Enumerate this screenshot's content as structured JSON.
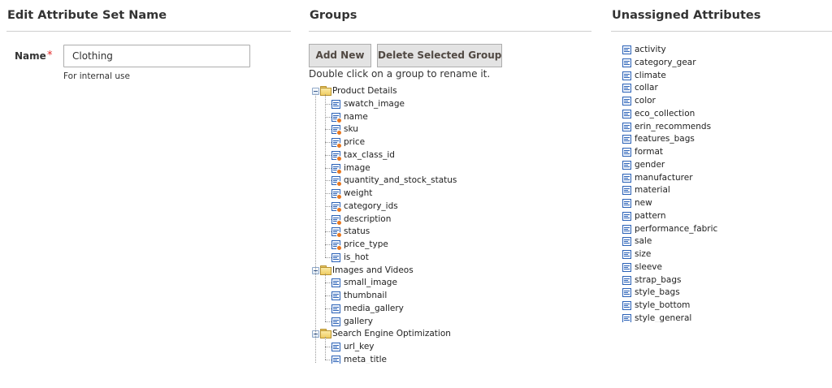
{
  "name_section": {
    "title": "Edit Attribute Set Name",
    "label": "Name",
    "required": "*",
    "value": "Clothing",
    "note": "For internal use"
  },
  "groups_section": {
    "title": "Groups",
    "add_label": "Add New",
    "delete_label": "Delete Selected Group",
    "hint": "Double click on a group to rename it.",
    "groups": [
      {
        "name": "Product Details",
        "items": [
          {
            "label": "swatch_image",
            "system": false
          },
          {
            "label": "name",
            "system": true
          },
          {
            "label": "sku",
            "system": true
          },
          {
            "label": "price",
            "system": true
          },
          {
            "label": "tax_class_id",
            "system": true
          },
          {
            "label": "image",
            "system": true
          },
          {
            "label": "quantity_and_stock_status",
            "system": true
          },
          {
            "label": "weight",
            "system": true
          },
          {
            "label": "category_ids",
            "system": true
          },
          {
            "label": "description",
            "system": true
          },
          {
            "label": "status",
            "system": true
          },
          {
            "label": "price_type",
            "system": true
          },
          {
            "label": "is_hot",
            "system": false
          }
        ]
      },
      {
        "name": "Images and Videos",
        "items": [
          {
            "label": "small_image",
            "system": false
          },
          {
            "label": "thumbnail",
            "system": false
          },
          {
            "label": "media_gallery",
            "system": false
          },
          {
            "label": "gallery",
            "system": false
          }
        ]
      },
      {
        "name": "Search Engine Optimization",
        "items": [
          {
            "label": "url_key",
            "system": false
          },
          {
            "label": "meta_title",
            "system": false
          }
        ]
      }
    ]
  },
  "unassigned_section": {
    "title": "Unassigned Attributes",
    "items": [
      "activity",
      "category_gear",
      "climate",
      "collar",
      "color",
      "eco_collection",
      "erin_recommends",
      "features_bags",
      "format",
      "gender",
      "manufacturer",
      "material",
      "new",
      "pattern",
      "performance_fabric",
      "sale",
      "size",
      "sleeve",
      "strap_bags",
      "style_bags",
      "style_bottom",
      "style_general"
    ]
  }
}
